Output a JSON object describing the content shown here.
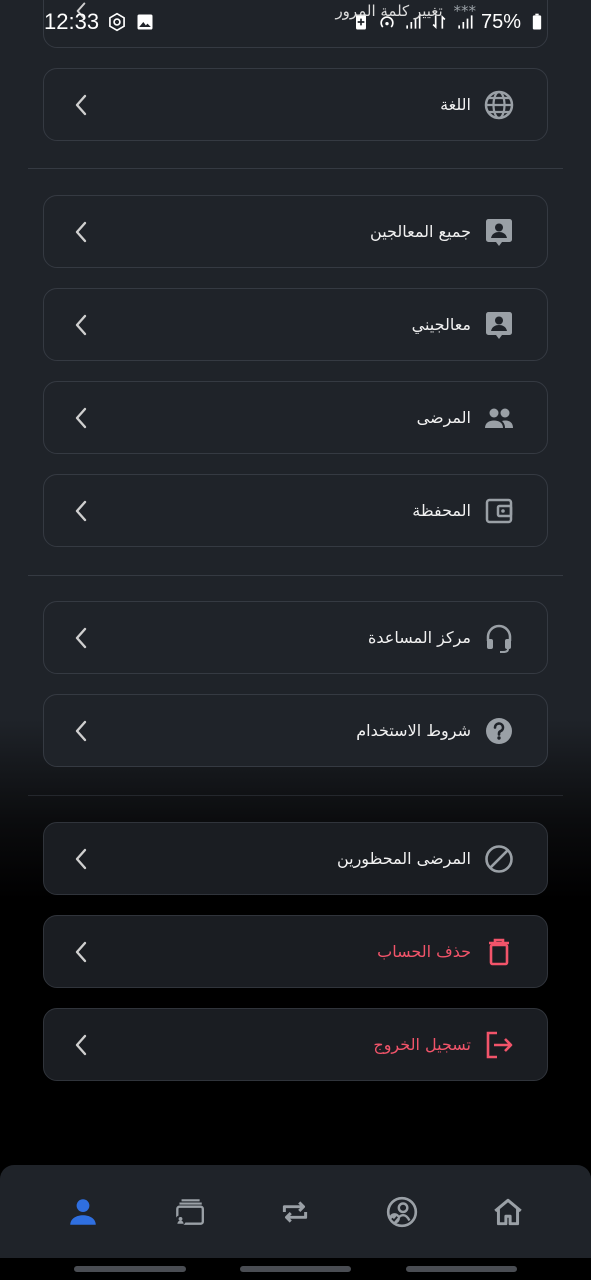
{
  "status_bar": {
    "time": "12:33",
    "battery": "75%",
    "icons": [
      "settings-gear-icon",
      "gallery-icon",
      "battery-saver-icon",
      "hotspot-icon",
      "signal-icon",
      "data-arrows-icon",
      "signal-icon-2",
      "battery-icon"
    ]
  },
  "partial_item": {
    "label": "تغيير كلمة المرور",
    "masked": "***"
  },
  "sections": {
    "language": {
      "label": "اللغة",
      "icon": "globe-icon"
    },
    "all_therapists": {
      "label": "جميع المعالجين",
      "icon": "contact-card-icon"
    },
    "my_therapists": {
      "label": "معالجيني",
      "icon": "contact-card-icon"
    },
    "patients": {
      "label": "المرضى",
      "icon": "people-icon"
    },
    "wallet": {
      "label": "المحفظة",
      "icon": "wallet-icon"
    },
    "help_center": {
      "label": "مركز المساعدة",
      "icon": "headset-icon"
    },
    "terms": {
      "label": "شروط الاستخدام",
      "icon": "help-circle-icon"
    },
    "blocked_patients": {
      "label": "المرضى المحظورين",
      "icon": "block-icon"
    },
    "delete_account": {
      "label": "حذف الحساب",
      "icon": "trash-icon"
    },
    "logout": {
      "label": "تسجيل الخروج",
      "icon": "logout-icon"
    }
  },
  "bottom_nav": {
    "items": [
      "profile-icon",
      "sessions-icon",
      "exchange-icon",
      "therapist-verified-icon",
      "home-icon"
    ],
    "active": "profile-icon"
  },
  "colors": {
    "background": "#1f2329",
    "accent": "#2f6fe0",
    "danger": "#f2546a",
    "icon_gray": "#9aa0a6"
  }
}
